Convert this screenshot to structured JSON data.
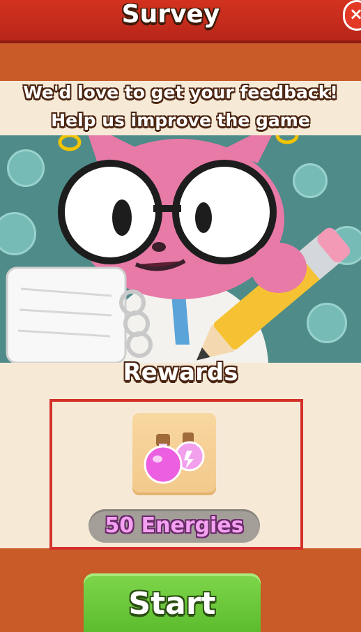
{
  "header": {
    "title": "Survey",
    "close_icon": "×"
  },
  "intro": {
    "line1": "We'd love to get your feedback!",
    "line2": "Help us improve the game"
  },
  "rewards": {
    "title": "Rewards",
    "item_label": "50 Energies",
    "item_icon": "energy-potion-icon"
  },
  "actions": {
    "start_label": "Start"
  },
  "colors": {
    "header": "#c6281c",
    "panel": "#f6ead7",
    "hero_bg": "#4e8b89",
    "reward_highlight": "#d4302a",
    "start_button": "#6ccb3c",
    "energy_text": "#f3a1f0"
  }
}
